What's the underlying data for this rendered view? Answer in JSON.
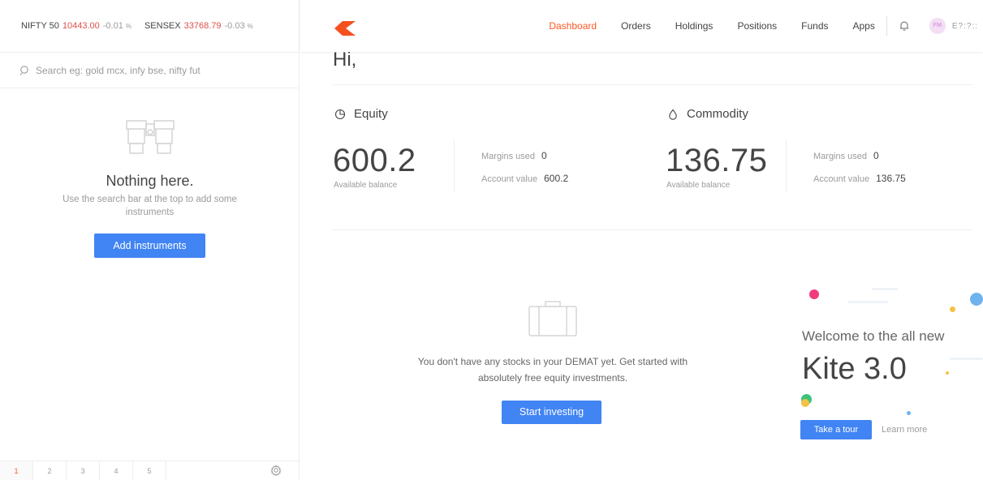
{
  "ticker": {
    "nifty": {
      "name": "NIFTY 50",
      "value": "10443.00",
      "change": "-0.01",
      "pct": "%"
    },
    "sensex": {
      "name": "SENSEX",
      "value": "33768.79",
      "change": "-0.03",
      "pct": "%"
    }
  },
  "search": {
    "placeholder": "Search eg: gold mcx, infy bse, nifty fut"
  },
  "watchlist": {
    "empty_title": "Nothing here.",
    "empty_desc": "Use the search bar at the top to add some instruments",
    "add_button": "Add instruments",
    "pages": [
      "1",
      "2",
      "3",
      "4",
      "5"
    ],
    "active_page": "1"
  },
  "nav": {
    "items": [
      "Dashboard",
      "Orders",
      "Holdings",
      "Positions",
      "Funds",
      "Apps"
    ],
    "active": "Dashboard",
    "avatar_initials": "FM",
    "user_id": "E?:?::"
  },
  "colors": {
    "accent": "#ff5722",
    "primary_button": "#4184f3",
    "negative": "#df514c"
  },
  "greeting": "Hi,",
  "equity": {
    "title": "Equity",
    "icon": "pie-chart-icon",
    "balance": "600.2",
    "balance_label": "Available balance",
    "margins_label": "Margins used",
    "margins_value": "0",
    "account_label": "Account value",
    "account_value": "600.2"
  },
  "commodity": {
    "title": "Commodity",
    "icon": "drop-icon",
    "balance": "136.75",
    "balance_label": "Available balance",
    "margins_label": "Margins used",
    "margins_value": "0",
    "account_label": "Account value",
    "account_value": "136.75"
  },
  "holdings_empty": {
    "message": "You don't have any stocks in your DEMAT yet. Get started with absolutely free equity investments.",
    "button": "Start investing"
  },
  "promo": {
    "welcome": "Welcome to the all new",
    "product": "Kite 3.0",
    "tour_button": "Take a tour",
    "learn_more": "Learn more"
  }
}
